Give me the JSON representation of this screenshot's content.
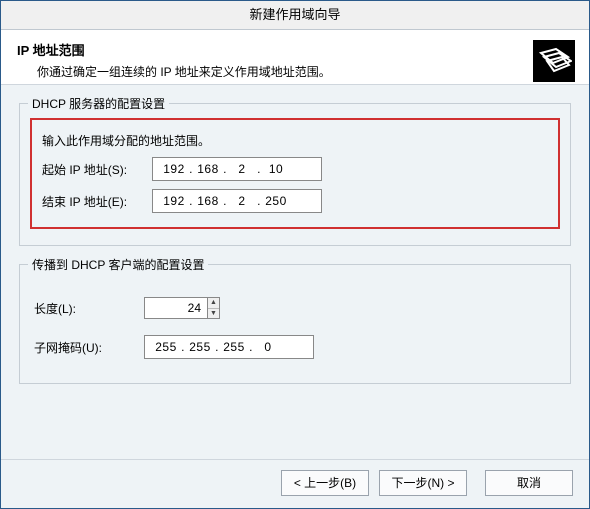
{
  "window": {
    "title": "新建作用域向导"
  },
  "header": {
    "title": "IP 地址范围",
    "subtitle": "你通过确定一组连续的 IP 地址来定义作用域地址范围。"
  },
  "group_server": {
    "legend": "DHCP 服务器的配置设置",
    "note": "输入此作用域分配的地址范围。",
    "start_label": "起始 IP 地址(S):",
    "end_label": "结束 IP 地址(E):",
    "start_ip": {
      "o1": "192",
      "o2": "168",
      "o3": "2",
      "o4": "10"
    },
    "end_ip": {
      "o1": "192",
      "o2": "168",
      "o3": "2",
      "o4": "250"
    }
  },
  "group_client": {
    "legend": "传播到 DHCP 客户端的配置设置",
    "length_label": "长度(L):",
    "length_value": "24",
    "mask_label": "子网掩码(U):",
    "mask": {
      "o1": "255",
      "o2": "255",
      "o3": "255",
      "o4": "0"
    }
  },
  "buttons": {
    "back": "< 上一步(B)",
    "next": "下一步(N) >",
    "cancel": "取消"
  }
}
